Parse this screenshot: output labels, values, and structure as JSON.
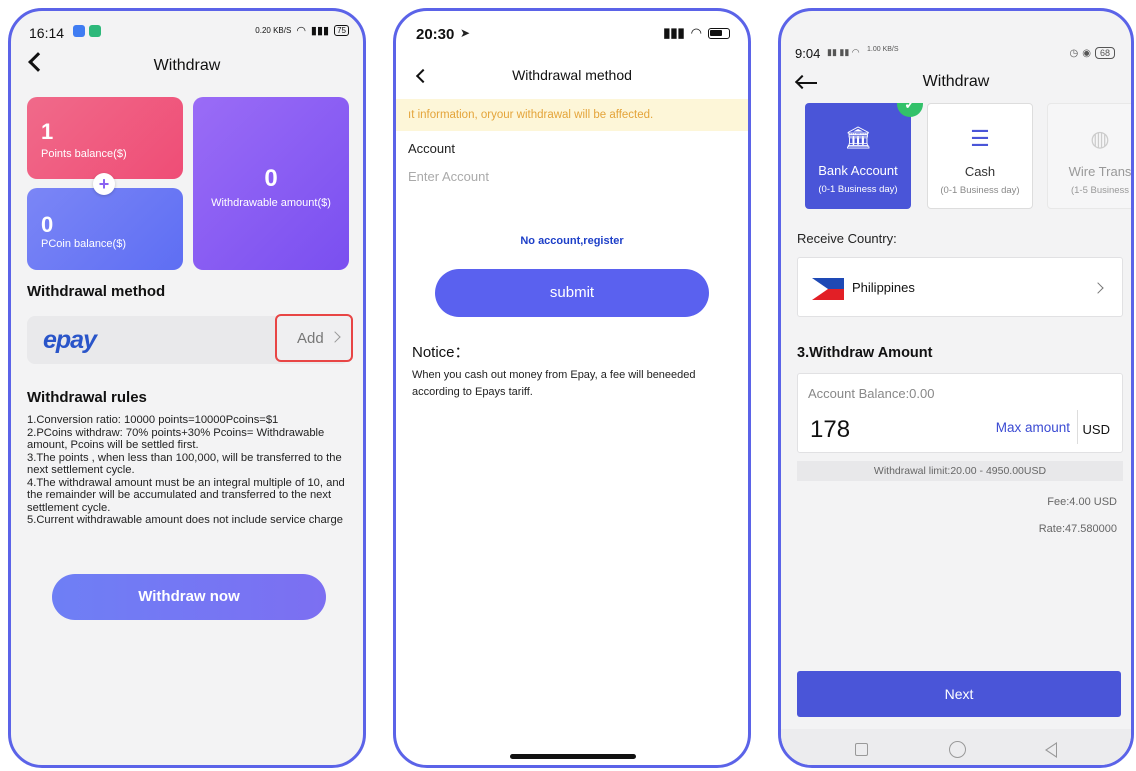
{
  "phone1": {
    "status": {
      "time": "16:14",
      "speed": "0.20 KB/S",
      "battery": "75"
    },
    "title": "Withdraw",
    "cards": {
      "points_value": "1",
      "points_label": "Points balance($)",
      "pcoin_value": "0",
      "pcoin_label": "PCoin balance($)",
      "withdrawable_value": "0",
      "withdrawable_label": "Withdrawable amount($)"
    },
    "method_title": "Withdrawal method",
    "method_logo": "epay",
    "add_label": "Add",
    "rules_title": "Withdrawal rules",
    "rules": [
      "1.Conversion ratio: 10000 points=10000Pcoins=$1",
      "2.PCoins withdraw: 70% points+30% Pcoins= Withdrawable amount, Pcoins will be settled first.",
      "3.The points , when less than 100,000, will be transferred to the next settlement cycle.",
      "4.The withdrawal amount must be an integral multiple of 10, and the remainder will be accumulated and transferred to the next settlement cycle.",
      "5.Current withdrawable amount does not include service charge"
    ],
    "withdraw_button": "Withdraw now"
  },
  "phone2": {
    "status": {
      "time": "20:30"
    },
    "title": "Withdrawal method",
    "warning": "ıt information, oryour withdrawal will be affected.",
    "account_label": "Account",
    "account_placeholder": "Enter Account",
    "register_link": "No account,register",
    "submit_button": "submit",
    "notice_title": "Notice：",
    "notice_body": "When you cash out money from Epay, a fee will beneeded according to Epays tariff."
  },
  "phone3": {
    "status": {
      "time": "9:04",
      "speed": "1.00 KB/S",
      "battery": "68"
    },
    "title": "Withdraw",
    "methods": [
      {
        "name": "Bank Account",
        "sub": "(0-1 Business day)",
        "selected": true
      },
      {
        "name": "Cash",
        "sub": "(0-1 Business day)",
        "selected": false
      },
      {
        "name": "Wire Trans",
        "sub": "(1-5 Business",
        "selected": false
      }
    ],
    "receive_label": "Receive Country:",
    "country": "Philippines",
    "amount_title": "3.Withdraw Amount",
    "balance": "Account Balance:0.00",
    "amount_value": "178",
    "max_amount": "Max amount",
    "currency": "USD",
    "limit": "Withdrawal limit:20.00 - 4950.00USD",
    "fee": "Fee:4.00 USD",
    "rate": "Rate:47.580000",
    "next_button": "Next"
  },
  "colors": {
    "accent": "#5a61ef",
    "pink": "#ef4d76",
    "purple": "#7a4ff0",
    "add_border": "#e84545",
    "warning_text": "#e4a43a",
    "success": "#33c16a"
  }
}
